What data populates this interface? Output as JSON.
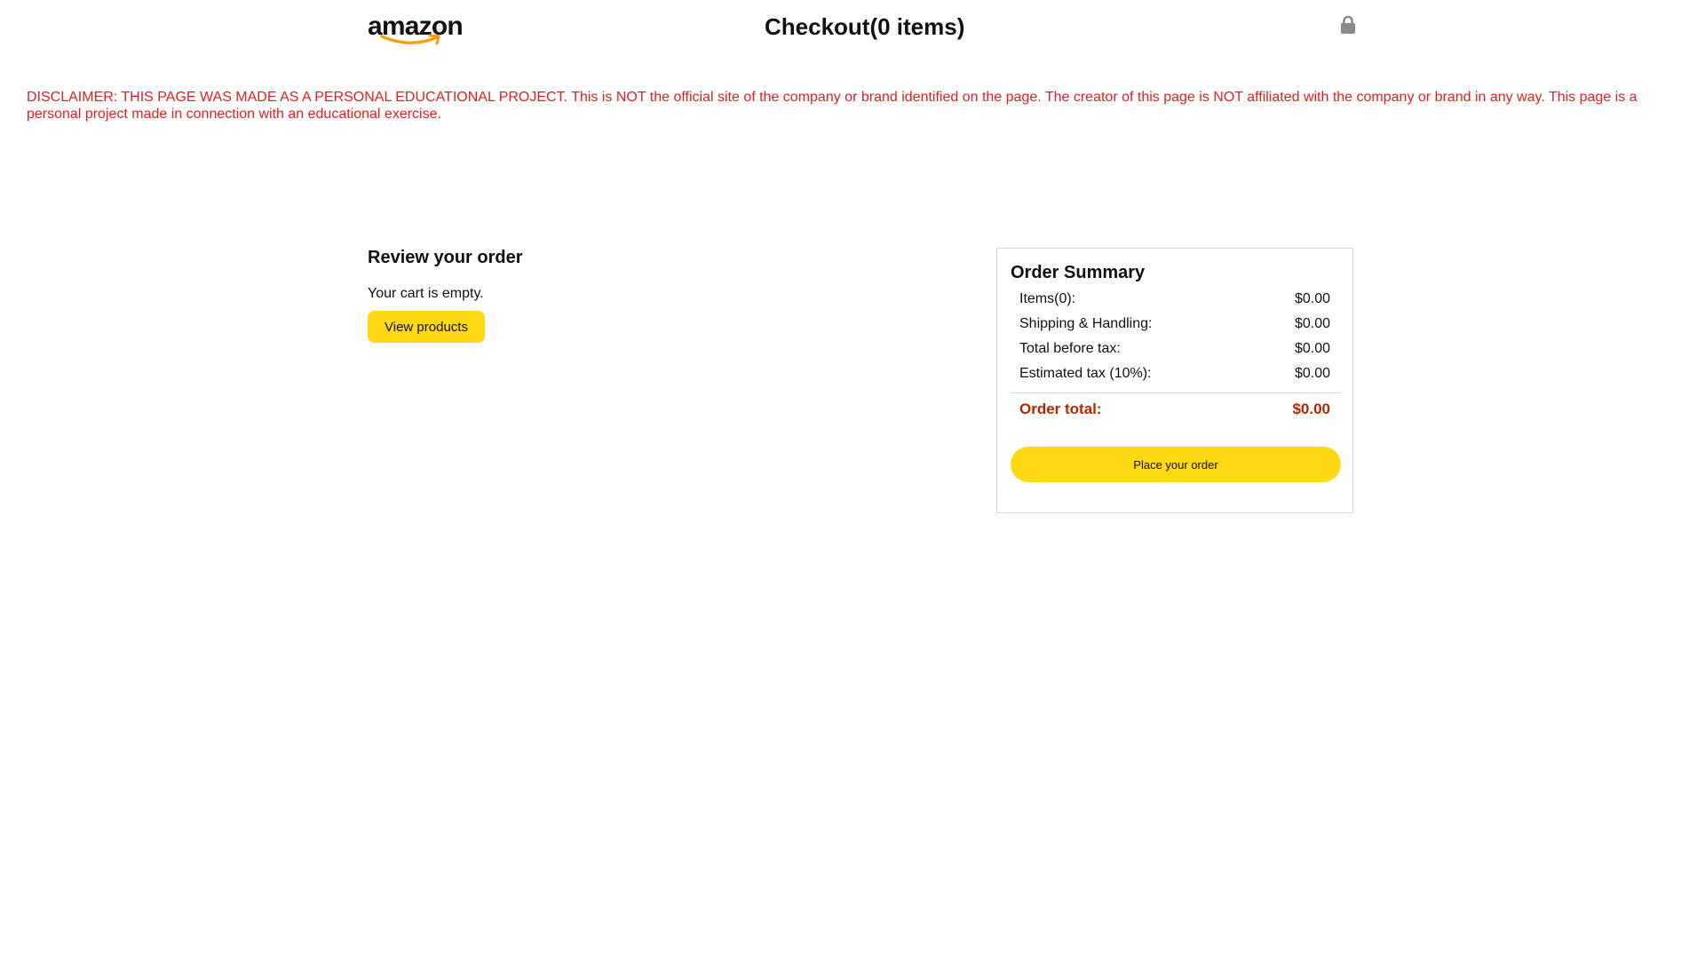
{
  "header": {
    "logo_text": "amazon",
    "logo_icon": "amazon-smile-logo",
    "title": "Checkout(0 items)",
    "lock_icon": "lock-icon"
  },
  "disclaimer": {
    "text": "DISCLAIMER: THIS PAGE WAS MADE AS A PERSONAL EDUCATIONAL PROJECT. This is NOT the official site of the company or brand identified on the page. The creator of this page is NOT affiliated with the company or brand in any way. This page is a personal project made in connection with an educational exercise."
  },
  "review": {
    "title": "Review your order",
    "empty_message": "Your cart is empty.",
    "view_products_label": "View products"
  },
  "summary": {
    "title": "Order Summary",
    "rows": [
      {
        "label": "Items(0):",
        "value": "$0.00"
      },
      {
        "label": "Shipping & Handling:",
        "value": "$0.00"
      },
      {
        "label": "Total before tax:",
        "value": "$0.00"
      },
      {
        "label": "Estimated tax (10%):",
        "value": "$0.00"
      }
    ],
    "total": {
      "label": "Order total:",
      "value": "$0.00"
    },
    "place_order_label": "Place your order"
  },
  "colors": {
    "accent_button": "#ffd814",
    "disclaimer_red": "#e02020",
    "total_red": "#b12704",
    "logo_orange": "#ff9900",
    "lock_gray": "#8a8a8a"
  }
}
